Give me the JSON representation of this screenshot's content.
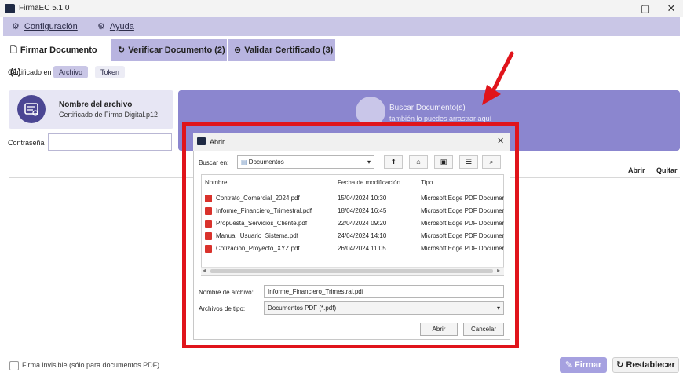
{
  "window": {
    "title": "FirmaEC 5.1.0"
  },
  "menu": {
    "items": [
      {
        "label": "Configuración",
        "icon": "gear-icon"
      },
      {
        "label": "Ayuda",
        "icon": "gear-icon"
      }
    ]
  },
  "tabs": [
    {
      "label": "Firmar Documento (1)"
    },
    {
      "label": "Verificar Documento (2)"
    },
    {
      "label": "Validar Certificado (3)"
    }
  ],
  "cert": {
    "label": "Certificado en",
    "options": [
      "Archivo",
      "Token"
    ],
    "selected": "Archivo"
  },
  "file_panel": {
    "title": "Nombre del archivo",
    "subtitle": "Certificado de Firma Digital.p12"
  },
  "search_panel": {
    "title": "Buscar Documento(s)",
    "subtitle": "también lo puedes arrastrar aquí"
  },
  "password": {
    "label": "Contraseña",
    "value": ""
  },
  "actions": {
    "open": "Abrir",
    "quit": "Quitar"
  },
  "dialog": {
    "title": "Abrir",
    "look_in_label": "Buscar en:",
    "look_in_value": "Documentos",
    "columns": [
      "Nombre",
      "Fecha de modificación",
      "Tipo"
    ],
    "files": [
      {
        "name": "Contrato_Comercial_2024.pdf",
        "date": "15/04/2024 10:30",
        "type": "Microsoft Edge PDF Document"
      },
      {
        "name": "Informe_Financiero_Trimestral.pdf",
        "date": "18/04/2024 16:45",
        "type": "Microsoft Edge PDF Document"
      },
      {
        "name": "Propuesta_Servicios_Cliente.pdf",
        "date": "22/04/2024 09:20",
        "type": "Microsoft Edge PDF Document"
      },
      {
        "name": "Manual_Usuario_Sistema.pdf",
        "date": "24/04/2024 14:10",
        "type": "Microsoft Edge PDF Document"
      },
      {
        "name": "Cotizacion_Proyecto_XYZ.pdf",
        "date": "26/04/2024 11:05",
        "type": "Microsoft Edge PDF Document"
      }
    ],
    "filename_label": "Nombre de archivo:",
    "filename_value": "Informe_Financiero_Trimestral.pdf",
    "filetype_label": "Archivos de tipo:",
    "filetype_value": "Documentos PDF (*.pdf)",
    "open_button": "Abrir",
    "cancel_button": "Cancelar"
  },
  "footer": {
    "invisible_label": "Firma invisible (sólo para documentos PDF)",
    "sign_button": "Firmar",
    "reset_button": "Restablecer"
  },
  "colors": {
    "accent": "#8b86cf",
    "menu_bg": "#c9c6e6",
    "highlight": "#e0141b",
    "arrow": "#e0141b"
  }
}
